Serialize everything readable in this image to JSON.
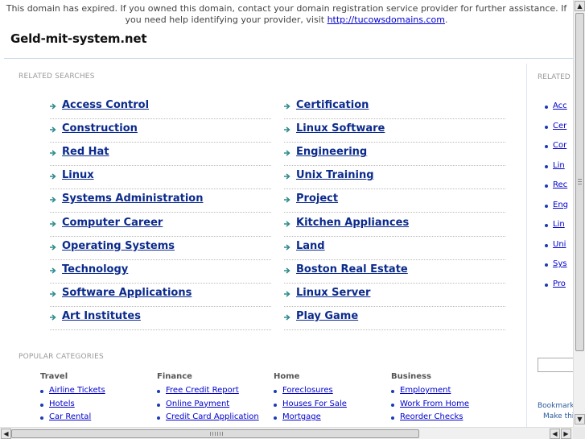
{
  "notice": {
    "text": "This domain has expired. If you owned this domain, contact your domain registration service provider for further assistance. If you need help identifying your provider, visit ",
    "link": "http://tucowsdomains.com",
    "end": "."
  },
  "domain": "Geld-mit-system.net",
  "related": {
    "title": "RELATED SEARCHES",
    "left": [
      "Access Control",
      "Construction",
      "Red Hat",
      "Linux",
      "Systems Administration",
      "Computer Career",
      "Operating Systems",
      "Technology",
      "Software Applications",
      "Art Institutes"
    ],
    "right": [
      "Certification",
      "Linux Software",
      "Engineering",
      "Unix Training",
      "Project",
      "Kitchen Appliances",
      "Land",
      "Boston Real Estate",
      "Linux Server",
      "Play Game"
    ]
  },
  "popular": {
    "title": "POPULAR CATEGORIES",
    "columns": [
      {
        "head": "Travel",
        "items": [
          "Airline Tickets",
          "Hotels",
          "Car Rental"
        ]
      },
      {
        "head": "Finance",
        "items": [
          "Free Credit Report",
          "Online Payment",
          "Credit Card Application"
        ]
      },
      {
        "head": "Home",
        "items": [
          "Foreclosures",
          "Houses For Sale",
          "Mortgage"
        ]
      },
      {
        "head": "Business",
        "items": [
          "Employment",
          "Work From Home",
          "Reorder Checks"
        ]
      }
    ]
  },
  "sidebar": {
    "title": "RELATED",
    "items": [
      "Acc",
      "Cer",
      "Cor",
      "Lin",
      "Rec",
      "Eng",
      "Lin",
      "Uni",
      "Sys",
      "Pro"
    ],
    "bookmark": "Bookmark",
    "make_this": "Make this"
  },
  "colors": {
    "link": "#0b2a8c",
    "arrow": "#2e8b8b",
    "divider": "#c9d7e6"
  },
  "icons": {
    "arrow": "right-arrow-icon",
    "bullet": "bullet-icon"
  }
}
